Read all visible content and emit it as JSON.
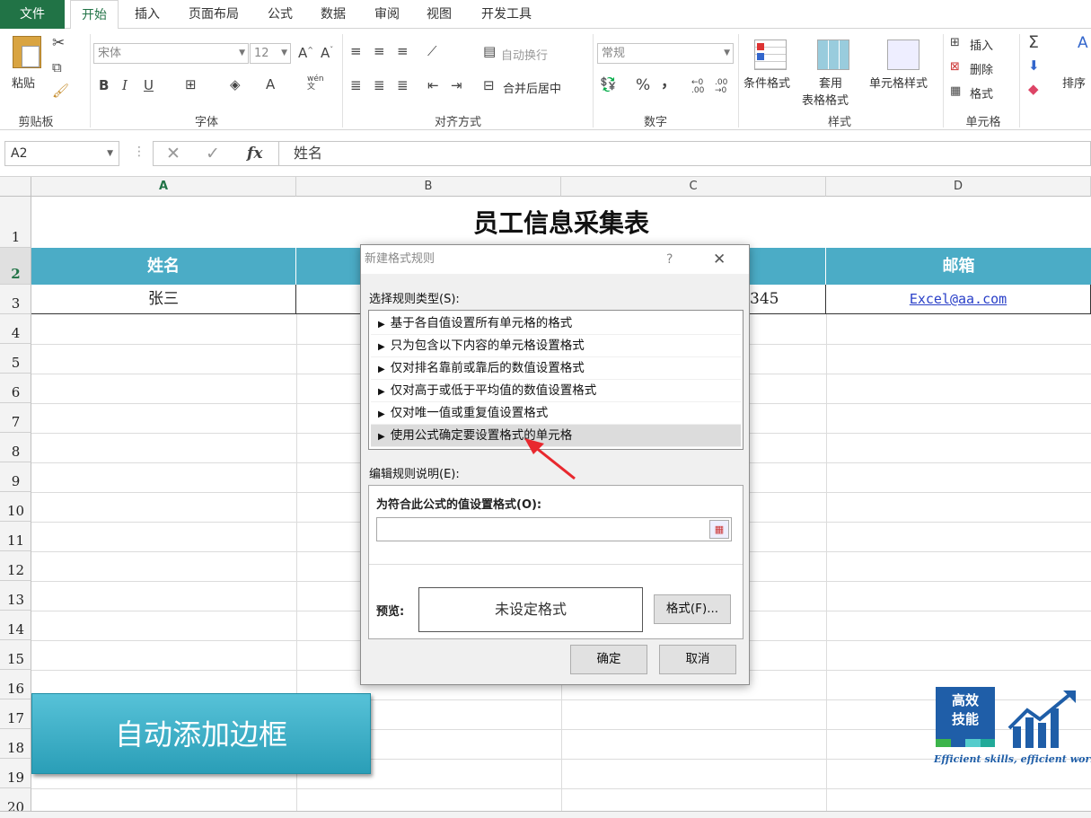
{
  "tabs": [
    "文件",
    "开始",
    "插入",
    "页面布局",
    "公式",
    "数据",
    "审阅",
    "视图",
    "开发工具"
  ],
  "ribbon": {
    "clipboard": {
      "paste": "粘贴",
      "label": "剪贴板"
    },
    "font": {
      "name": "宋体",
      "size": "12",
      "label": "字体",
      "bold": "B",
      "italic": "I",
      "underline": "U",
      "phonetic": "wén"
    },
    "alignment": {
      "wrap": "自动换行",
      "merge": "合并后居中",
      "label": "对齐方式"
    },
    "number": {
      "format": "常规",
      "percent": "%",
      "comma": "，",
      "label": "数字"
    },
    "styles": {
      "conditional": "条件格式",
      "table1": "套用",
      "table2": "表格格式",
      "cell_styles": "单元格样式",
      "label": "样式"
    },
    "cells": {
      "insert": "插入",
      "delete": "删除",
      "format": "格式",
      "label": "单元格"
    },
    "editing": {
      "sigma": "Σ",
      "sort": "排序"
    }
  },
  "formula_bar": {
    "name_box": "A2",
    "fx": "fx",
    "value": "姓名"
  },
  "columns": [
    "A",
    "B",
    "C",
    "D"
  ],
  "rows": [
    "1",
    "2",
    "3",
    "4",
    "5",
    "6",
    "7",
    "8",
    "9",
    "10",
    "11",
    "12",
    "13",
    "14",
    "15",
    "16",
    "17",
    "18",
    "19",
    "20"
  ],
  "sheet": {
    "title": "员工信息采集表",
    "header_a": "姓名",
    "header_d": "邮箱",
    "row3_a": "张三",
    "row3_c_partial": "345",
    "row3_d": "Excel@aa.com"
  },
  "button_label": "自动添加边框",
  "logo": {
    "line1": "高效",
    "line2": "技能",
    "slogan": "Efficient skills, efficient work !"
  },
  "dialog": {
    "title": "新建格式规则",
    "help": "?",
    "close": "✕",
    "rule_type_label": "选择规则类型(S):",
    "rules": [
      "基于各自值设置所有单元格的格式",
      "只为包含以下内容的单元格设置格式",
      "仅对排名靠前或靠后的数值设置格式",
      "仅对高于或低于平均值的数值设置格式",
      "仅对唯一值或重复值设置格式",
      "使用公式确定要设置格式的单元格"
    ],
    "edit_label": "编辑规则说明(E):",
    "formula_label": "为符合此公式的值设置格式(O):",
    "preview_label": "预览:",
    "preview_text": "未设定格式",
    "format_button": "格式(F)...",
    "ok": "确定",
    "cancel": "取消"
  },
  "colors": {
    "excel_green": "#217346",
    "header_fill": "#4bacc6",
    "button_fill": "#2a9eb7",
    "logo_blue": "#1f5ea8",
    "arrow_red": "#e8282e"
  }
}
